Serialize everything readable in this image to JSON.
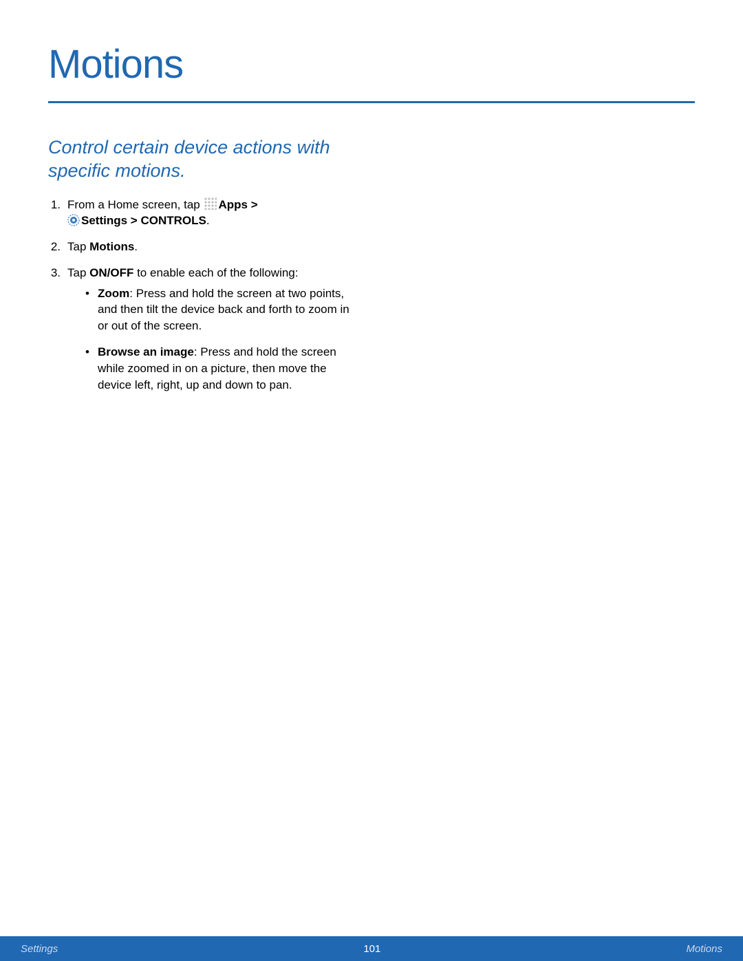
{
  "title": "Motions",
  "subtitle": "Control certain device actions with specific motions.",
  "steps": {
    "s1": {
      "num": "1.",
      "t1": "From a Home screen, tap ",
      "apps": "Apps ",
      "gt": "> ",
      "settings": "Settings ",
      "gt2": " > ",
      "controls": "CONTROLS",
      "period": "."
    },
    "s2": {
      "num": "2.",
      "t1": "Tap ",
      "motions": "Motions",
      "period": "."
    },
    "s3": {
      "num": "3.",
      "t1": "Tap ",
      "onoff": "ON/OFF",
      "t2": " to enable each of the following:"
    }
  },
  "bullets": {
    "b1": {
      "name": "Zoom",
      "rest": ": Press and hold the screen at two points, and then tilt the device back and forth to zoom in or out of the screen."
    },
    "b2": {
      "name": "Browse an image",
      "rest": ": Press and hold the screen while zoomed in on a picture, then move the device left, right, up and down to pan."
    }
  },
  "footer": {
    "left": "Settings",
    "center": "101",
    "right": "Motions"
  }
}
